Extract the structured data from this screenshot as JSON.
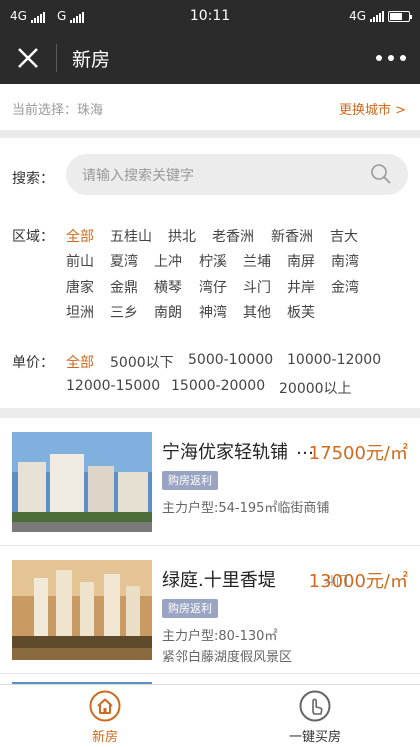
{
  "status_bar": {
    "carrier1": "4G",
    "carrier2": "G",
    "time": "10:11",
    "net": "4G"
  },
  "navbar": {
    "title": "新房"
  },
  "city": {
    "label": "当前选择：珠海",
    "change": "更换城市 >"
  },
  "search": {
    "label": "搜索：",
    "placeholder": "请输入搜索关键字"
  },
  "region": {
    "label": "区域：",
    "options": [
      "全部",
      "五桂山",
      "拱北",
      "老香洲",
      "新香洲",
      "吉大",
      "前山",
      "夏湾",
      "上冲",
      "柠溪",
      "兰埔",
      "南屏",
      "南湾",
      "唐家",
      "金鼎",
      "横琴",
      "湾仔",
      "斗门",
      "井岸",
      "金湾",
      "坦洲",
      "三乡",
      "南朗",
      "神湾",
      "其他",
      "板芙"
    ],
    "selected": "全部"
  },
  "price": {
    "label": "单价：",
    "options": [
      "全部",
      "5000以下",
      "5000-10000",
      "10000-12000",
      "12000-15000",
      "15000-20000",
      "20000以上"
    ],
    "selected": "全部"
  },
  "listings": [
    {
      "name": "宁海优家轻轨铺",
      "more": "…",
      "area": "",
      "price": "17500元/㎡",
      "badge": "购房返利",
      "type": "主力户型:54-195㎡临街商铺",
      "feature": ""
    },
    {
      "name": "绿庭.十里香堤",
      "more": "",
      "area": "斗门",
      "price": "13000元/㎡",
      "badge": "购房返利",
      "type": "主力户型:80-130㎡",
      "feature": "紧邻白藤湖度假风景区"
    }
  ],
  "tabs": [
    {
      "label": "新房",
      "active": true
    },
    {
      "label": "一键买房",
      "active": false
    }
  ],
  "colors": {
    "accent": "#d06a1e",
    "navbar": "#2b2b2b",
    "badge": "#98a4c2"
  }
}
